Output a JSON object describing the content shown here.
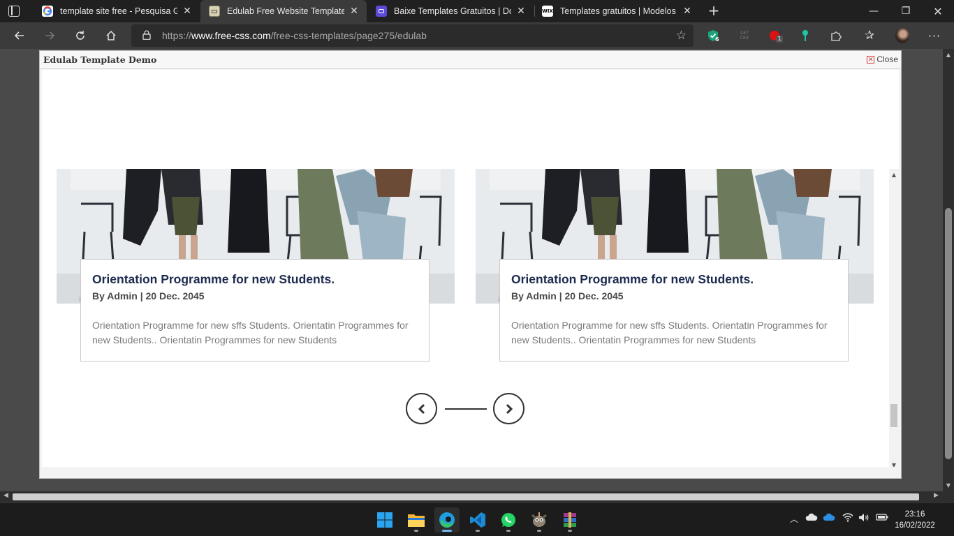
{
  "browser": {
    "tabs": [
      {
        "label": "template site free - Pesquisa Goo",
        "favicon": "google-icon",
        "active": false
      },
      {
        "label": "Edulab Free Website Template | F",
        "favicon": "freecss-icon",
        "active": true
      },
      {
        "label": "Baixe Templates Gratuitos | Dow",
        "favicon": "templates-icon",
        "active": false
      },
      {
        "label": "Templates gratuitos | Modelos de",
        "favicon": "wix-icon",
        "active": false
      }
    ],
    "wix_favicon_text": "WIX",
    "url_prefix": "https://",
    "url_domain": "www.free-css.com",
    "url_path": "/free-css-templates/page275/edulab",
    "extension_badges": {
      "shield": "6",
      "gcx_line1": "GET",
      "gcx_line2": "CRX",
      "red": "1"
    }
  },
  "modal": {
    "title": "Edulab Template Demo",
    "close_label": "Close"
  },
  "cards": [
    {
      "title": "Orientation Programme for new Students.",
      "meta": "By Admin | 20 Dec. 2045",
      "text": "Orientation Programme for new sffs Students. Orientatin Programmes for new Students.. Orientatin Programmes for new Students"
    },
    {
      "title": "Orientation Programme for new Students.",
      "meta": "By Admin | 20 Dec. 2045",
      "text": "Orientation Programme for new sffs Students. Orientatin Programmes for new Students.. Orientatin Programmes for new Students"
    }
  ],
  "taskbar": {
    "apps": [
      "windows-start-icon",
      "file-explorer-icon",
      "edge-icon",
      "vscode-icon",
      "whatsapp-icon",
      "gimp-icon",
      "winrar-icon"
    ],
    "time": "23:16",
    "date": "16/02/2022"
  },
  "colors": {
    "card_title": "#1b2a4e",
    "accent_blue": "#6cb8f6",
    "chrome_dark": "#202020"
  }
}
